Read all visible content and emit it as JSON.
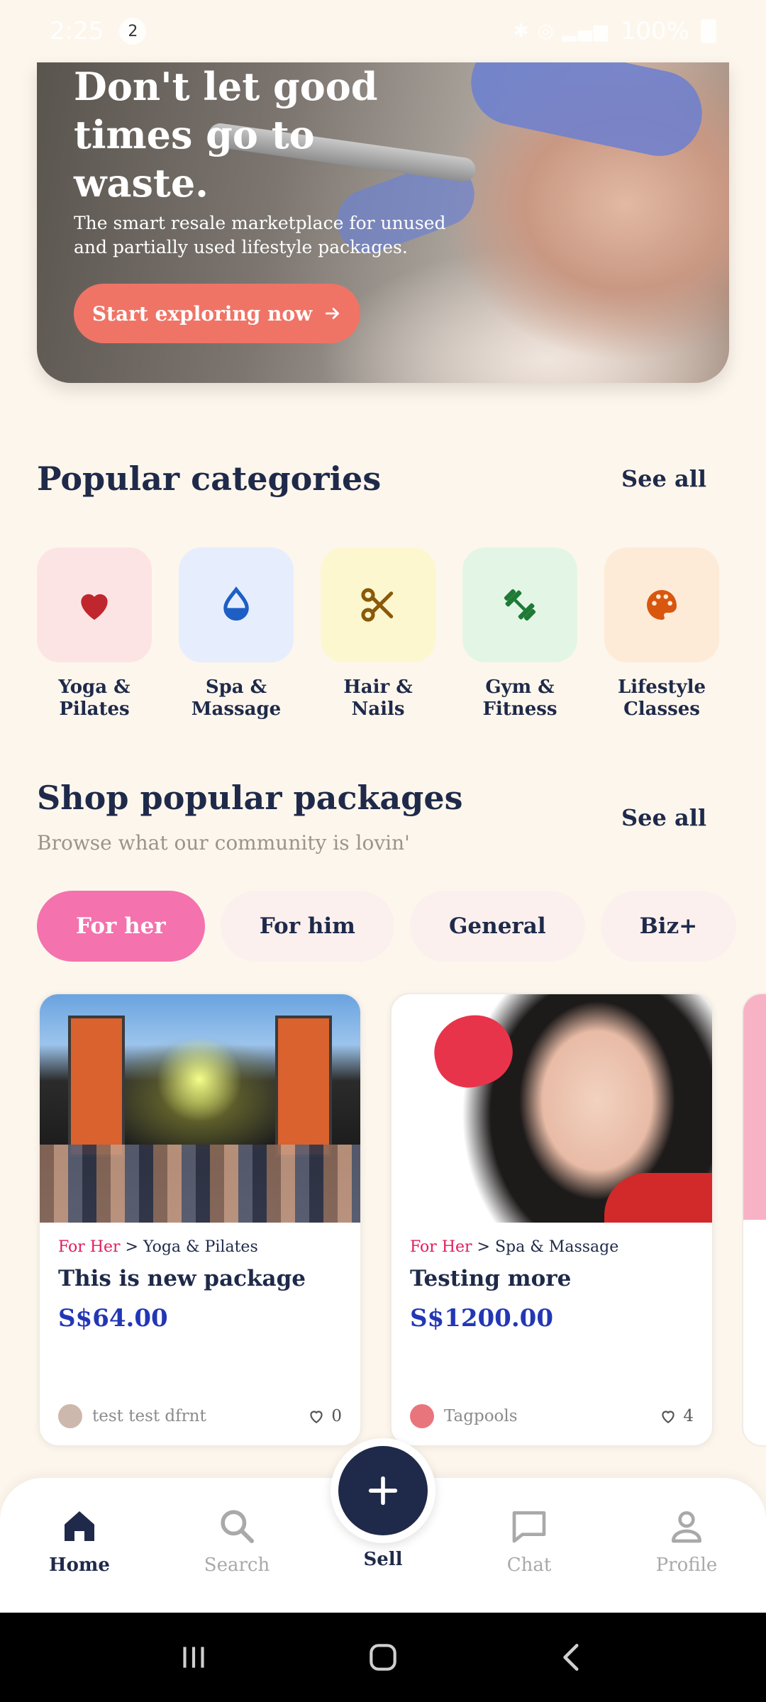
{
  "status_bar": {
    "time": "2:25",
    "notification_count": "2",
    "battery": "100%"
  },
  "hero": {
    "title": "Don't let good times go to waste.",
    "subtitle": "The smart resale marketplace for unused and partially used lifestyle packages.",
    "cta_label": "Start exploring now",
    "cta_icon": "arrow-right-icon"
  },
  "categories_section": {
    "title": "Popular categories",
    "see_all": "See all",
    "items": [
      {
        "label": "Yoga & Pilates",
        "icon": "heart-icon",
        "bg": "#fde4e4",
        "color": "#c0262d"
      },
      {
        "label": "Spa & Massage",
        "icon": "water-drop-icon",
        "bg": "#e6eefe",
        "color": "#1d5fc4"
      },
      {
        "label": "Hair & Nails",
        "icon": "scissors-icon",
        "bg": "#fdf7cf",
        "color": "#8a5a0a"
      },
      {
        "label": "Gym & Fitness",
        "icon": "dumbbell-icon",
        "bg": "#e3f6e6",
        "color": "#1f7a35"
      },
      {
        "label": "Lifestyle Classes",
        "icon": "palette-icon",
        "bg": "#fdebd8",
        "color": "#d9560f"
      }
    ]
  },
  "packages_section": {
    "title": "Shop popular packages",
    "subtitle": "Browse what our community is lovin'",
    "see_all": "See all",
    "filters": [
      {
        "label": "For her",
        "active": true
      },
      {
        "label": "For him",
        "active": false
      },
      {
        "label": "General",
        "active": false
      },
      {
        "label": "Biz+",
        "active": false
      }
    ],
    "cards": [
      {
        "category": "For Her",
        "subcategory": " > Yoga & Pilates",
        "title": "This is new package",
        "price": "S$64.00",
        "seller": "test test dfrnt",
        "likes": "0"
      },
      {
        "category": "For Her",
        "subcategory": " > Spa & Massage",
        "title": "Testing more",
        "price": "S$1200.00",
        "seller": "Tagpools",
        "likes": "4"
      }
    ]
  },
  "bottom_nav": {
    "home": "Home",
    "search": "Search",
    "sell": "Sell",
    "chat": "Chat",
    "profile": "Profile"
  },
  "colors": {
    "background": "#fdf6ec",
    "navy": "#1f2a4a",
    "cta": "#ef7466",
    "chip_active": "#f472ad",
    "price": "#2337b5",
    "category_accent": "#e11d5a"
  }
}
